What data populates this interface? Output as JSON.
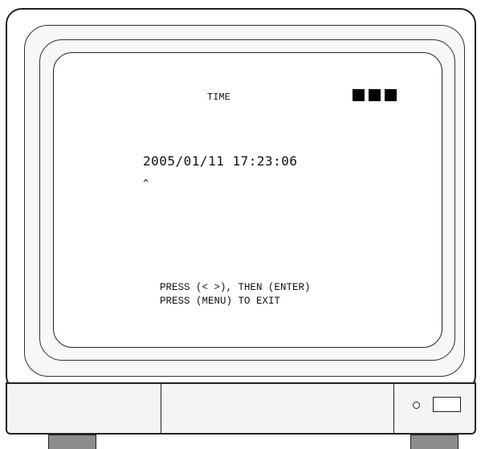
{
  "osd": {
    "title": "TIME",
    "status_blocks": 3,
    "datetime": "2005/01/11 17:23:06",
    "cursor": "^",
    "instructions": [
      "PRESS (< >), THEN (ENTER)",
      "PRESS (MENU) TO EXIT"
    ]
  },
  "colors": {
    "frame": "#222222",
    "screen": "#ffffff",
    "bezel": "#f7f7f7",
    "feet": "#8c8c8c",
    "blocks": "#000000"
  },
  "icons": [
    "led-indicator-icon",
    "power-button-icon",
    "status-block-icon"
  ]
}
